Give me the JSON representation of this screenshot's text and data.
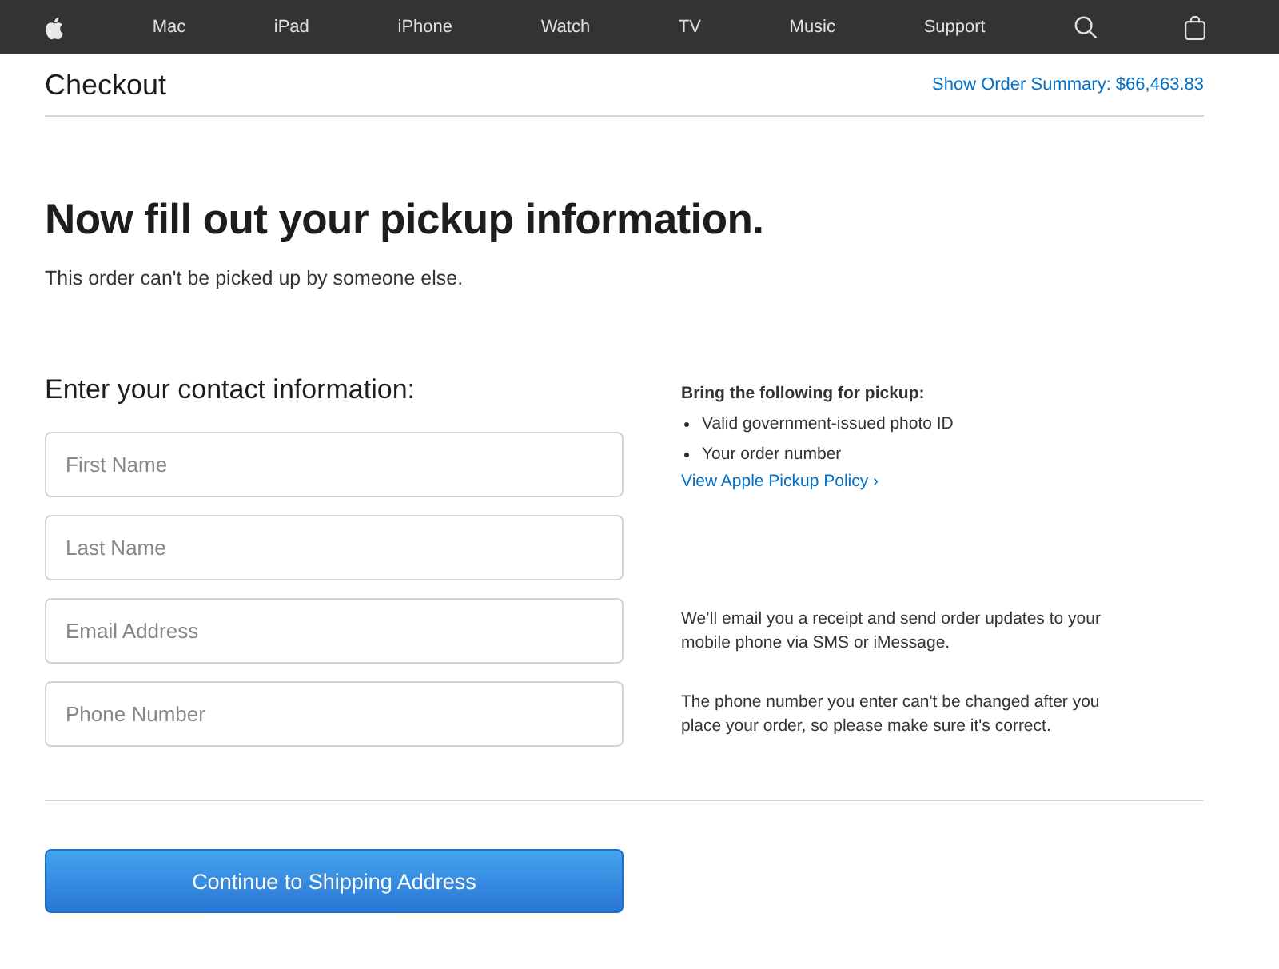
{
  "nav": {
    "links": [
      "Mac",
      "iPad",
      "iPhone",
      "Watch",
      "TV",
      "Music",
      "Support"
    ]
  },
  "header": {
    "title": "Checkout",
    "summary_link": "Show Order Summary: $66,463.83"
  },
  "intro": {
    "heading": "Now fill out your pickup information.",
    "subheading": "This order can't be picked up by someone else."
  },
  "contact": {
    "title": "Enter your contact information:",
    "fields": [
      {
        "placeholder": "First Name"
      },
      {
        "placeholder": "Last Name"
      },
      {
        "placeholder": "Email Address"
      },
      {
        "placeholder": "Phone Number"
      }
    ]
  },
  "pickup": {
    "title": "Bring the following for pickup:",
    "items": [
      "Valid government-issued photo ID",
      "Your order number"
    ],
    "link": "View Apple Pickup Policy ›"
  },
  "notes": [
    "We’ll email you a receipt and send order updates to your mobile phone via SMS or iMessage.",
    "The phone number you enter can't be changed after you place your order, so please make sure it's correct."
  ],
  "button": {
    "label": "Continue to Shipping Address"
  }
}
